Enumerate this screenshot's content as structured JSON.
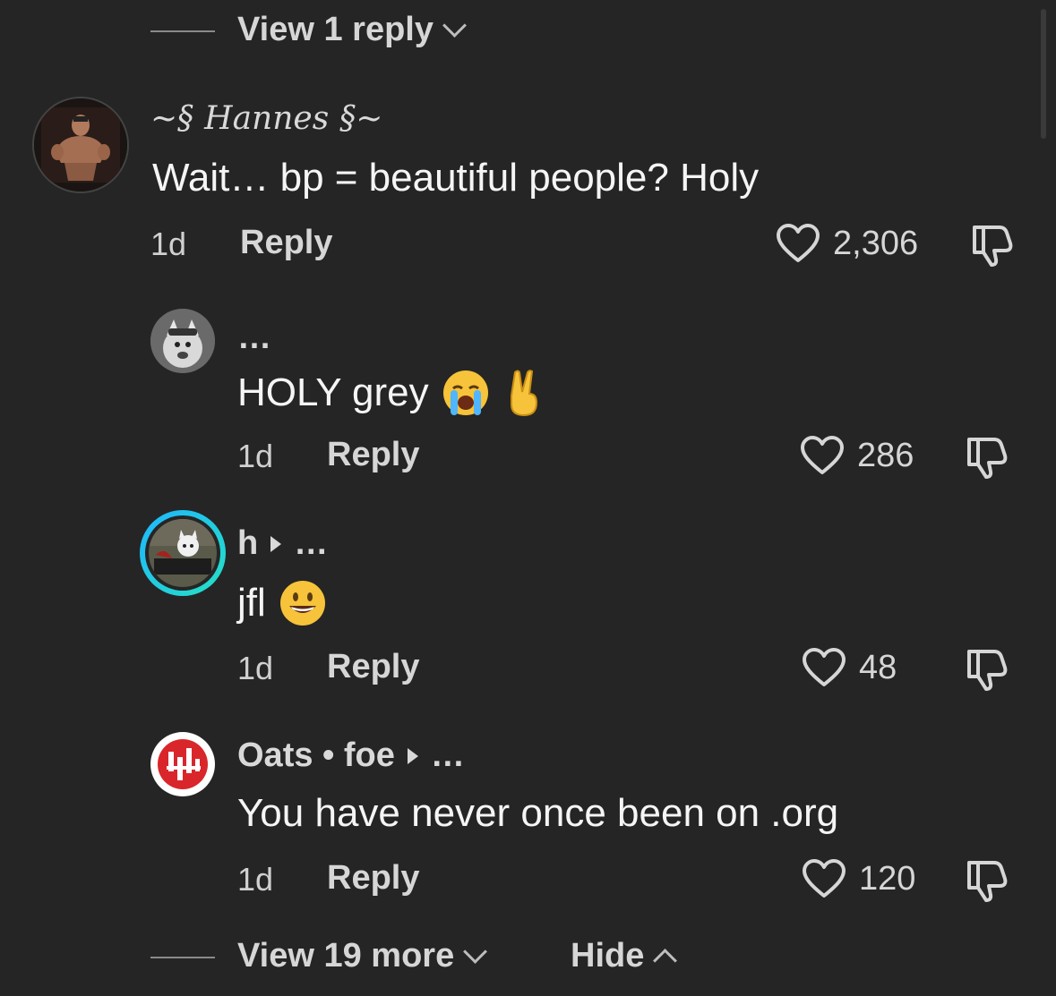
{
  "top_view_reply": {
    "label": "View 1 reply"
  },
  "comments": [
    {
      "username": "Hannes",
      "text": "Wait… bp = beautiful people? Holy",
      "time": "1d",
      "reply_label": "Reply",
      "likes": "2,306"
    },
    {
      "username": "…",
      "text": "HOLY grey",
      "emojis": [
        "😭",
        "✌️"
      ],
      "time": "1d",
      "reply_label": "Reply",
      "likes": "286"
    },
    {
      "username": "h",
      "username_suffix": "…",
      "text": "jfl",
      "emojis": [
        "😃"
      ],
      "time": "1d",
      "reply_label": "Reply",
      "likes": "48"
    },
    {
      "username": "Oats • foe",
      "username_suffix": "…",
      "text": "You have never once been on .org",
      "time": "1d",
      "reply_label": "Reply",
      "likes": "120"
    }
  ],
  "footer": {
    "view_more_label": "View 19 more",
    "hide_label": "Hide"
  },
  "colors": {
    "background": "#252525",
    "story_ring_start": "#1fb6ff",
    "story_ring_end": "#25e0c4",
    "oats_red": "#d9262b"
  }
}
